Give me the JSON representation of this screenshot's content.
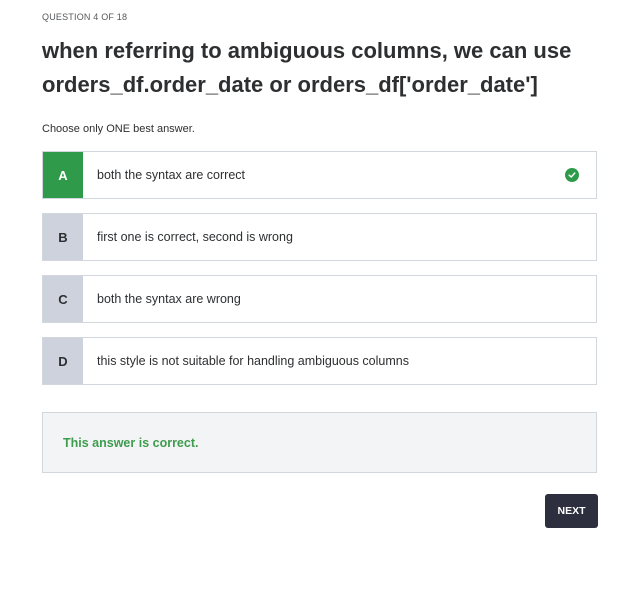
{
  "header": {
    "counter": "QUESTION 4 OF 18"
  },
  "question": {
    "text": "when referring to ambiguous columns, we can use orders_df.order_date or orders_df['order_date']"
  },
  "instruction": "Choose only ONE best answer.",
  "options": [
    {
      "letter": "A",
      "text": "both the syntax are correct",
      "correct": true
    },
    {
      "letter": "B",
      "text": "first one is correct, second is wrong",
      "correct": false
    },
    {
      "letter": "C",
      "text": "both the syntax are wrong",
      "correct": false
    },
    {
      "letter": "D",
      "text": "this style is not suitable for handling ambiguous columns",
      "correct": false
    }
  ],
  "feedback": {
    "text": "This answer is correct."
  },
  "actions": {
    "next_label": "NEXT"
  },
  "colors": {
    "correct": "#2f9b4a",
    "letter_bg": "#cdd2dc",
    "button_bg": "#2d2f3f"
  },
  "icons": {
    "correct_mark": "check-circle-icon"
  }
}
